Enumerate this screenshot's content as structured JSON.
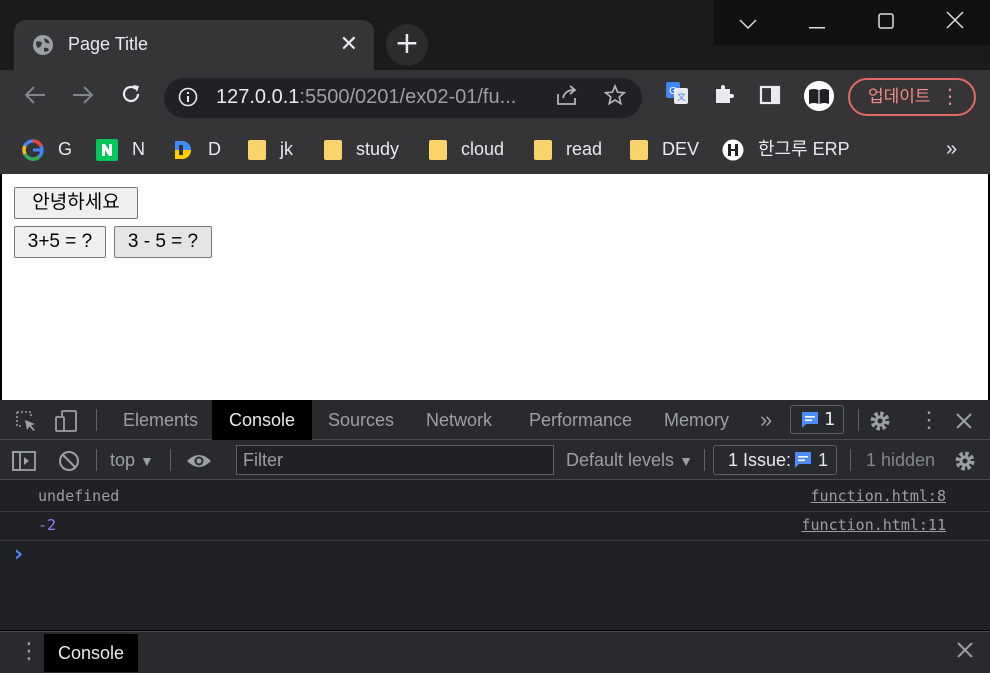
{
  "browser": {
    "tab_title": "Page Title",
    "new_tab": "+",
    "url_host": "127.0.0.1",
    "url_rest": ":5500/0201/ex02-01/fu...",
    "update_label": "업데이트",
    "window_controls": [
      "﹀",
      "─",
      "☐",
      "✕"
    ]
  },
  "bookmarks": [
    {
      "label": "G",
      "icon": "google-icon"
    },
    {
      "label": "N",
      "icon": "naver-icon"
    },
    {
      "label": "D",
      "icon": "daum-icon"
    },
    {
      "label": "jk",
      "icon": "folder-icon"
    },
    {
      "label": "study",
      "icon": "folder-icon"
    },
    {
      "label": "cloud",
      "icon": "folder-icon"
    },
    {
      "label": "read",
      "icon": "folder-icon"
    },
    {
      "label": "DEV",
      "icon": "folder-icon"
    },
    {
      "label": "한그루 ERP",
      "icon": "erp-icon"
    }
  ],
  "bookmarks_more": "»",
  "page": {
    "buttons": [
      "안녕하세요",
      "3+5 = ?",
      "3 - 5 = ?"
    ]
  },
  "devtools": {
    "tabs": [
      "Elements",
      "Console",
      "Sources",
      "Network",
      "Performance",
      "Memory"
    ],
    "active_tab": "Console",
    "more_tabs": "»",
    "issue_count": "1",
    "context": "top",
    "filter_placeholder": "Filter",
    "levels": "Default levels",
    "issues_label": "1 Issue:",
    "issues_count": "1",
    "hidden": "1 hidden",
    "messages": [
      {
        "text": "undefined",
        "source": "function.html:8",
        "color": "#9aa0a6"
      },
      {
        "text": "-2",
        "source": "function.html:11",
        "color": "#9980ff"
      }
    ],
    "prompt": "›",
    "drawer_tab": "Console"
  }
}
